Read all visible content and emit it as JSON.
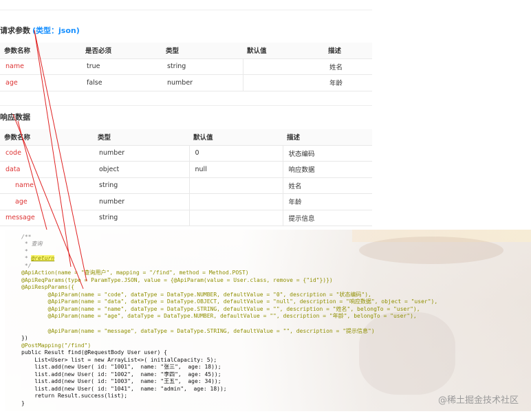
{
  "request": {
    "title": "请求参数",
    "tag": "(类型：json)",
    "headers": [
      "参数名称",
      "是否必须",
      "类型",
      "默认值",
      "描述"
    ],
    "rows": [
      {
        "name": "name",
        "required": "true",
        "type": "string",
        "default": "",
        "desc": "姓名"
      },
      {
        "name": "age",
        "required": "false",
        "type": "number",
        "default": "",
        "desc": "年龄"
      }
    ]
  },
  "response": {
    "title": "响应数据",
    "headers": [
      "参数名称",
      "类型",
      "默认值",
      "描述"
    ],
    "rows": [
      {
        "name": "code",
        "type": "number",
        "default": "0",
        "desc": "状态编码"
      },
      {
        "name": "data",
        "type": "object",
        "default": "null",
        "desc": "响应数据"
      },
      {
        "name": "name",
        "type": "string",
        "default": "",
        "desc": "姓名"
      },
      {
        "name": "age",
        "type": "number",
        "default": "",
        "desc": "年龄"
      },
      {
        "name": "message",
        "type": "string",
        "default": "",
        "desc": "提示信息"
      }
    ]
  },
  "code": {
    "l1": "/**",
    "l2": " * 查询",
    "l3": " *",
    "l4a": " * ",
    "l4b": "@return",
    "l5": " */",
    "l6": "@ApiAction(name = \"查询用户\", mapping = \"/find\", method = Method.POST)",
    "l7": "@ApiReqParams(type = ParamType.JSON, value = {@ApiParam(value = User.class, remove = {\"id\"})})",
    "l8": "@ApiRespParams({",
    "l9": "        @ApiParam(name = \"code\", dataType = DataType.NUMBER, defaultValue = \"0\", description = \"状态编码\"),",
    "l10": "        @ApiParam(name = \"data\", dataType = DataType.OBJECT, defaultValue = \"null\", description = \"响应数据\", object = \"user\"),",
    "l11": "        @ApiParam(name = \"name\", dataType = DataType.STRING, defaultValue = \"\", description = \"姓名\", belongTo = \"user\"),",
    "l12": "        @ApiParam(name = \"age\", dataType = DataType.NUMBER, defaultValue = \"\", description = \"年龄\", belongTo = \"user\"),",
    "l13": "",
    "l14": "        @ApiParam(name = \"message\", dataType = DataType.STRING, defaultValue = \"\", description = \"提示信息\")",
    "l15": "})",
    "l16": "@PostMapping(\"/find\")",
    "l17": "public Result find(@RequestBody User user) {",
    "l18": "    List<User> list = new ArrayList<>( initialCapacity: 5);",
    "l19": "    list.add(new User( id: \"1001\",  name: \"张三\",  age: 18));",
    "l20": "    list.add(new User( id: \"1002\",  name: \"李四\",  age: 45));",
    "l21": "    list.add(new User( id: \"1003\",  name: \"王五\",  age: 34));",
    "l22": "    list.add(new User( id: \"1041\",  name: \"admin\",  age: 18));",
    "l23": "    return Result.success(list);",
    "l24": "}"
  },
  "watermark": "@稀土掘金技术社区",
  "colors": {
    "accent": "#1890ff",
    "param_name": "#dd3333",
    "arrow": "#e02020"
  }
}
